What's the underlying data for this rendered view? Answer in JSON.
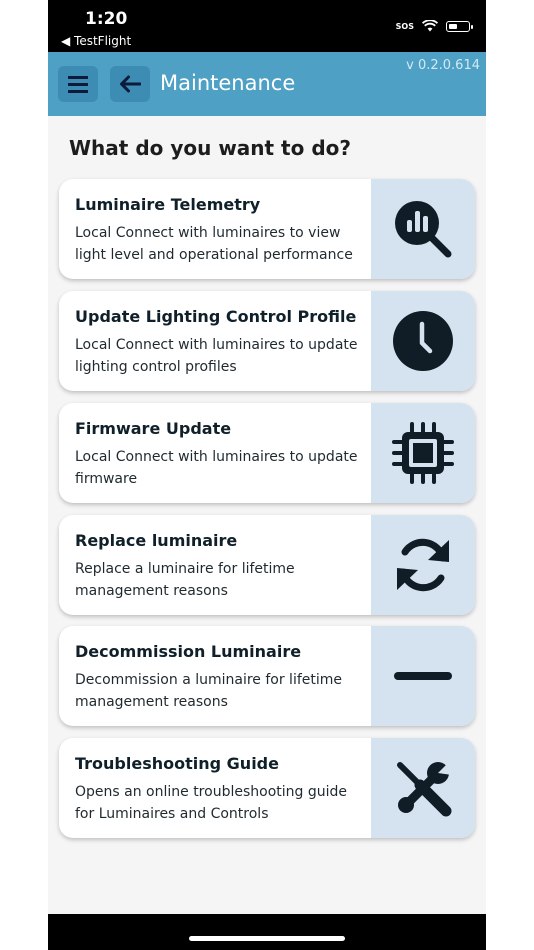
{
  "status_bar": {
    "time": "1:20",
    "back_app": "◀ TestFlight",
    "sos": "SOS",
    "battery_level": 0.45
  },
  "app_bar": {
    "title": "Maintenance",
    "version": "v 0.2.0.614",
    "menu_icon": "hamburger-icon",
    "back_icon": "arrow-left-icon",
    "color": "#4ea0c4"
  },
  "main": {
    "question": "What do you want to do?",
    "cards": [
      {
        "title": "Luminaire Telemetry",
        "description": "Local Connect with luminaires to view light level and operational performance",
        "icon": "chart-search-icon"
      },
      {
        "title": "Update Lighting Control Profile",
        "description": "Local Connect with luminaires to update lighting control profiles",
        "icon": "clock-icon"
      },
      {
        "title": "Firmware Update",
        "description": "Local Connect with luminaires to update firmware",
        "icon": "chip-icon"
      },
      {
        "title": "Replace luminaire",
        "description": "Replace a luminaire for lifetime management reasons",
        "icon": "refresh-icon"
      },
      {
        "title": "Decommission Luminaire",
        "description": "Decommission a luminaire for lifetime management reasons",
        "icon": "minus-icon"
      },
      {
        "title": "Troubleshooting Guide",
        "description": "Opens an online troubleshooting guide for Luminaires and Controls",
        "icon": "tools-icon"
      }
    ]
  }
}
